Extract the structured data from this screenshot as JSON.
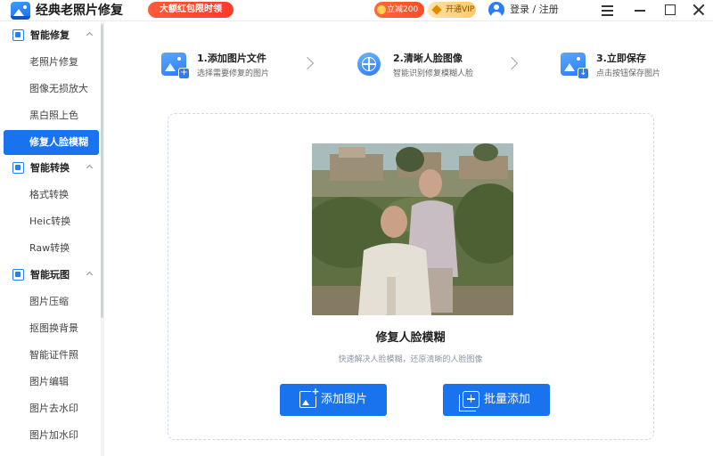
{
  "app": {
    "title": "经典老照片修复",
    "promo_label": "大额红包限时领",
    "coupon_label": "立减200元",
    "vip_label": "开通VIP",
    "login_label": "登录 / 注册"
  },
  "sidebar": {
    "groups": [
      {
        "label": "智能修复",
        "items": [
          "老照片修复",
          "图像无损放大",
          "黑白照上色",
          "修复人脸模糊"
        ],
        "active": "修复人脸模糊"
      },
      {
        "label": "智能转换",
        "items": [
          "格式转换",
          "Heic转换",
          "Raw转换"
        ]
      },
      {
        "label": "智能玩图",
        "items": [
          "图片压缩",
          "抠图换背景",
          "智能证件照",
          "图片编辑",
          "图片去水印",
          "图片加水印"
        ]
      }
    ]
  },
  "steps": [
    {
      "title": "1.添加图片文件",
      "desc": "选择需要修复的图片"
    },
    {
      "title": "2.清晰人脸图像",
      "desc": "智能识别修复模糊人脸"
    },
    {
      "title": "3.立即保存",
      "desc": "点击按钮保存图片"
    }
  ],
  "dropzone": {
    "title": "修复人脸模糊",
    "desc": "快速解决人脸模糊，还原清晰的人脸图像",
    "add_button": "添加图片",
    "batch_button": "批量添加"
  },
  "colors": {
    "accent": "#1a73ee",
    "promo": "#ff4a2a",
    "vip": "#ffc969"
  }
}
